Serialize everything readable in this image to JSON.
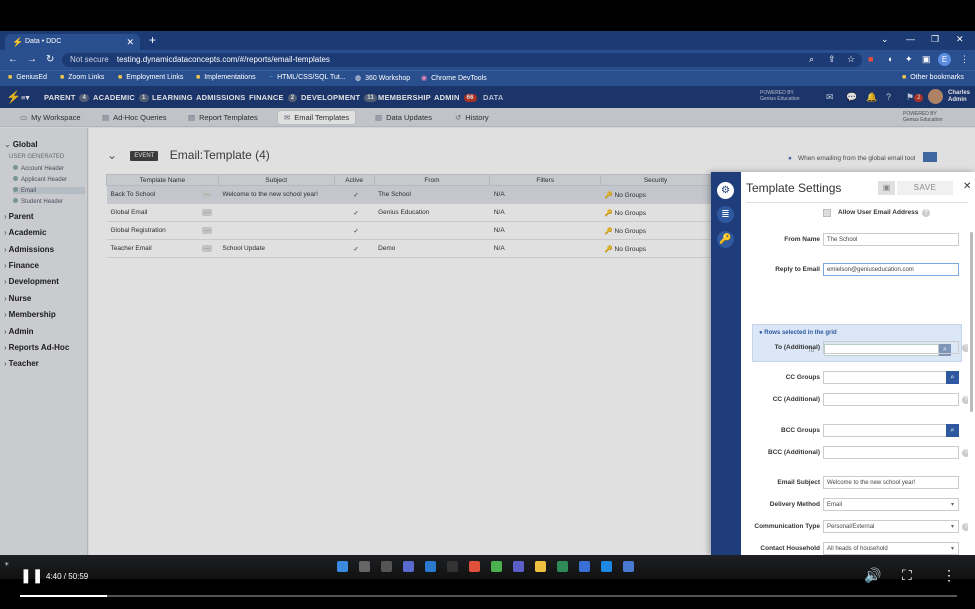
{
  "browser": {
    "tab_title": "Data • DDC",
    "not_secure": "Not secure",
    "url": "testing.dynamicdataconcepts.com/#/reports/email-templates",
    "profile_initial": "E",
    "bookmarks": [
      "GeniusEd",
      "Zoom Links",
      "Employment Links",
      "Implementations",
      "HTML/CSS/SQL Tut...",
      "360 Workshop",
      "Chrome DevTools"
    ],
    "other_bookmarks": "Other bookmarks"
  },
  "topnav": {
    "items": [
      {
        "label": "PARENT",
        "badge": "4"
      },
      {
        "label": "ACADEMIC",
        "badge": "1"
      },
      {
        "label": "LEARNING",
        "badge": ""
      },
      {
        "label": "ADMISSIONS",
        "badge": ""
      },
      {
        "label": "FINANCE",
        "badge": "2"
      },
      {
        "label": "DEVELOPMENT",
        "badge": "11"
      },
      {
        "label": "MEMBERSHIP",
        "badge": ""
      },
      {
        "label": "ADMIN",
        "badge": "66"
      },
      {
        "label": "DATA",
        "badge": ""
      }
    ],
    "powered_by": "POWERED BY",
    "powered_name": "Genius Education",
    "notification_count": "2",
    "user_first": "Charles",
    "user_role": "Admin"
  },
  "subnav": {
    "items": [
      "My Workspace",
      "Ad-Hoc Queries",
      "Report Templates",
      "Email Templates",
      "Data Updates",
      "History"
    ],
    "active": "Email Templates"
  },
  "sidebar": {
    "global": "Global",
    "user_generated": "USER GENERATED",
    "leaves": [
      "Account Header",
      "Applicant Header",
      "Email",
      "Student Header"
    ],
    "sections": [
      "Parent",
      "Academic",
      "Admissions",
      "Finance",
      "Development",
      "Nurse",
      "Membership",
      "Admin",
      "Reports Ad-Hoc",
      "Teacher"
    ]
  },
  "main": {
    "event_tag": "EVENT",
    "title": "Email:Template (4)",
    "hint": "When emailing from the global email tool",
    "columns": [
      "Template Name",
      "Subject",
      "Active",
      "From",
      "Filters",
      "Security"
    ],
    "rows": [
      {
        "name": "Back To School",
        "subject": "Welcome to the new school year!",
        "active": "✓",
        "from": "The School",
        "filters": "N/A",
        "security": "No Groups"
      },
      {
        "name": "Global Email",
        "subject": "",
        "active": "✓",
        "from": "Genius Education",
        "filters": "N/A",
        "security": "No Groups"
      },
      {
        "name": "Global Registration",
        "subject": "",
        "active": "✓",
        "from": "",
        "filters": "N/A",
        "security": "No Groups"
      },
      {
        "name": "Teacher Email",
        "subject": "School Update",
        "active": "✓",
        "from": "Demo",
        "filters": "N/A",
        "security": "No Groups"
      }
    ]
  },
  "panel": {
    "title": "Template Settings",
    "save": "SAVE",
    "allow_user_email": "Allow User Email Address",
    "from_name_label": "From Name",
    "from_name": "The School",
    "reply_label": "Reply to Email",
    "reply": "emielson@geniuseducation.com",
    "rows_selected": "Rows selected in the grid",
    "to_label": "To",
    "to_additional": "To (Additional)",
    "cc_groups": "CC Groups",
    "cc_additional": "CC (Additional)",
    "bcc_groups": "BCC Groups",
    "bcc_additional": "BCC (Additional)",
    "subject_label": "Email Subject",
    "subject": "Welcome to the new school year!",
    "delivery_label": "Delivery Method",
    "delivery": "Email",
    "comm_label": "Communication Type",
    "comm": "Personal/External",
    "household_label": "Contact Household",
    "household": "All heads of household"
  },
  "video": {
    "time": "4:40 / 50:59",
    "progress": 0.093
  }
}
